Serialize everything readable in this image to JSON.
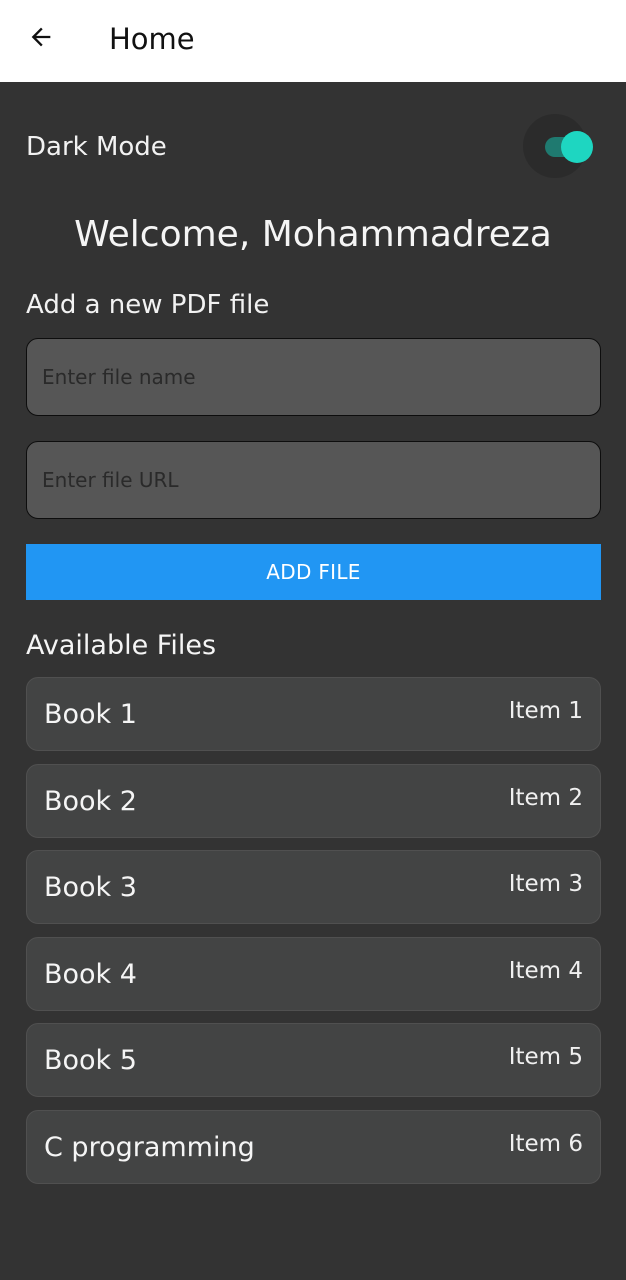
{
  "appbar": {
    "title": "Home",
    "back_icon": "arrow-left-icon"
  },
  "settings": {
    "dark_mode_label": "Dark Mode",
    "dark_mode_on": true,
    "toggle_color": "#1ed6c1"
  },
  "welcome": "Welcome, Mohammadreza",
  "add_section": {
    "label": "Add a new PDF file",
    "name_placeholder": "Enter file name",
    "url_placeholder": "Enter file URL",
    "button_label": "ADD FILE",
    "button_color": "#2196f3"
  },
  "files": {
    "heading": "Available Files",
    "items": [
      {
        "name": "Book 1",
        "tag": "Item 1"
      },
      {
        "name": "Book 2",
        "tag": "Item 2"
      },
      {
        "name": "Book 3",
        "tag": "Item 3"
      },
      {
        "name": "Book 4",
        "tag": "Item 4"
      },
      {
        "name": "Book 5",
        "tag": "Item 5"
      },
      {
        "name": "C programming",
        "tag": "Item 6"
      }
    ]
  }
}
